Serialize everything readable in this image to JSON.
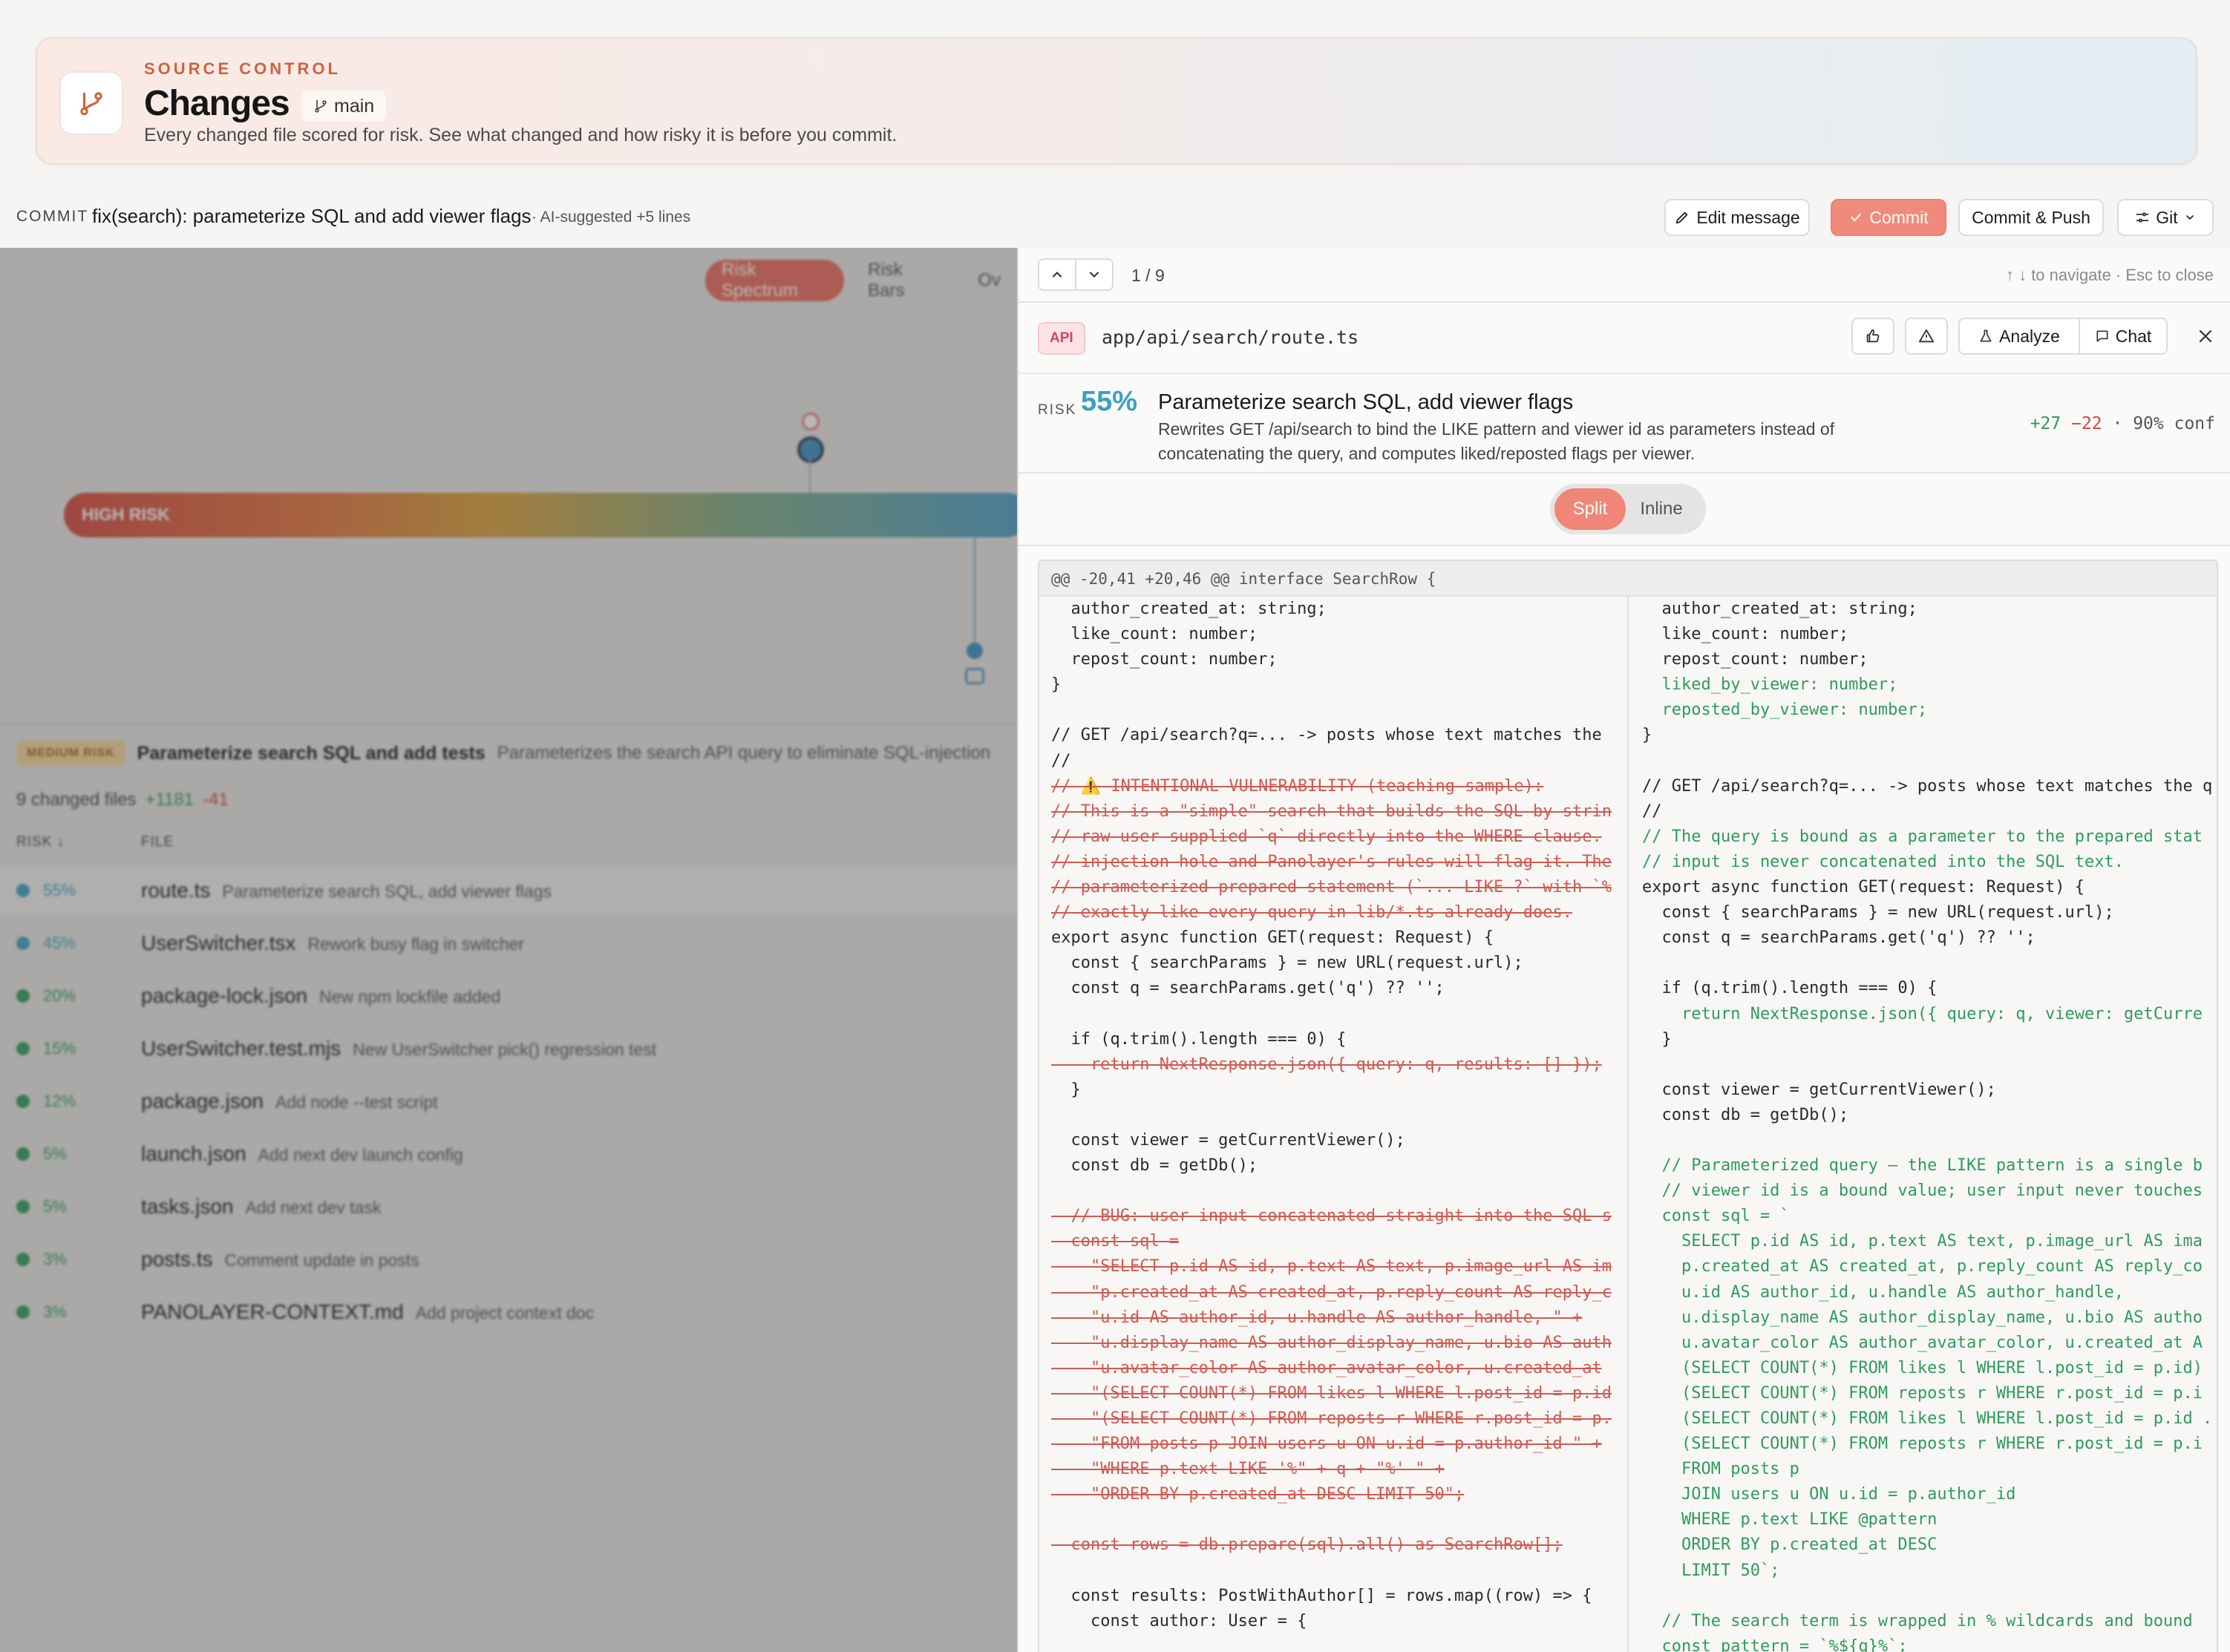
{
  "header": {
    "kicker": "SOURCE CONTROL",
    "title": "Changes",
    "branch": "main",
    "subtitle": "Every changed file scored for risk. See what changed and how risky it is before you commit."
  },
  "commit_bar": {
    "label": "COMMIT",
    "message": "fix(search): parameterize SQL and add viewer flags",
    "meta": "· AI-suggested  +5 lines",
    "edit_label": "Edit message",
    "commit_label": "Commit",
    "commit_push_label": "Commit & Push",
    "git_label": "Git"
  },
  "left": {
    "tabs": [
      "Risk Spectrum",
      "Risk Bars",
      "Ov"
    ],
    "spectrum_label": "HIGH RISK",
    "summary_badge": "MEDIUM RISK",
    "summary_title": "Parameterize search SQL and add tests",
    "summary_desc": "Parameterizes the search API query to eliminate SQL-injection",
    "changed_files": "9 changed files",
    "total_add": "+1181",
    "total_del": "-41",
    "col_risk": "RISK",
    "col_file": "FILE",
    "files": [
      {
        "pct": "55%",
        "name": "route.ts",
        "desc": "Parameterize search SQL, add viewer flags",
        "color": "#3aa0c4"
      },
      {
        "pct": "45%",
        "name": "UserSwitcher.tsx",
        "desc": "Rework busy flag in switcher",
        "color": "#3aa0c4"
      },
      {
        "pct": "20%",
        "name": "package-lock.json",
        "desc": "New npm lockfile added",
        "color": "#2f9b5c"
      },
      {
        "pct": "15%",
        "name": "UserSwitcher.test.mjs",
        "desc": "New UserSwitcher pick() regression test",
        "color": "#2f9b5c"
      },
      {
        "pct": "12%",
        "name": "package.json",
        "desc": "Add node --test script",
        "color": "#2f9b5c"
      },
      {
        "pct": "5%",
        "name": "launch.json",
        "desc": "Add next dev launch config",
        "color": "#2f9b5c"
      },
      {
        "pct": "5%",
        "name": "tasks.json",
        "desc": "Add next dev task",
        "color": "#2f9b5c"
      },
      {
        "pct": "3%",
        "name": "posts.ts",
        "desc": "Comment update in posts",
        "color": "#2f9b5c"
      },
      {
        "pct": "3%",
        "name": "PANOLAYER-CONTEXT.md",
        "desc": "Add project context doc",
        "color": "#2f9b5c"
      }
    ]
  },
  "detail": {
    "position": "1 / 9",
    "nav_hint": "↑ ↓ to navigate · Esc to close",
    "badge": "API",
    "path": "app/api/search/route.ts",
    "analyze_label": "Analyze",
    "chat_label": "Chat",
    "risk_label": "RISK",
    "risk_pct": "55%",
    "title": "Parameterize search SQL, add viewer flags",
    "desc": "Rewrites GET /api/search to bind the LIKE pattern and viewer id as parameters instead of concatenating the query, and computes liked/reposted flags per viewer.",
    "adds": "+27",
    "dels": "−22",
    "conf": "· 90% conf",
    "split_label": "Split",
    "inline_label": "Inline",
    "hunk": "@@ -20,41 +20,46 @@ interface SearchRow {",
    "left_lines": [
      {
        "t": "ctx",
        "s": "  author_created_at: string;"
      },
      {
        "t": "ctx",
        "s": "  like_count: number;"
      },
      {
        "t": "ctx",
        "s": "  repost_count: number;"
      },
      {
        "t": "ctx",
        "s": "}"
      },
      {
        "t": "ctx",
        "s": ""
      },
      {
        "t": "ctx",
        "s": "// GET /api/search?q=... -> posts whose text matches the"
      },
      {
        "t": "ctx",
        "s": "//"
      },
      {
        "t": "del",
        "s": "// ⚠️ INTENTIONAL VULNERABILITY (teaching sample):"
      },
      {
        "t": "del",
        "s": "// This is a \"simple\" search that builds the SQL by strin"
      },
      {
        "t": "del",
        "s": "// raw user-supplied `q` directly into the WHERE clause."
      },
      {
        "t": "del",
        "s": "// injection hole and Panolayer's rules will flag it. The"
      },
      {
        "t": "del",
        "s": "// parameterized prepared statement (`... LIKE ?` with `%"
      },
      {
        "t": "del",
        "s": "// exactly like every query in lib/*.ts already does."
      },
      {
        "t": "ctx",
        "s": "export async function GET(request: Request) {"
      },
      {
        "t": "ctx",
        "s": "  const { searchParams } = new URL(request.url);"
      },
      {
        "t": "ctx",
        "s": "  const q = searchParams.get('q') ?? '';"
      },
      {
        "t": "ctx",
        "s": ""
      },
      {
        "t": "ctx",
        "s": "  if (q.trim().length === 0) {"
      },
      {
        "t": "del",
        "s": "    return NextResponse.json({ query: q, results: [] });"
      },
      {
        "t": "ctx",
        "s": "  }"
      },
      {
        "t": "ctx",
        "s": ""
      },
      {
        "t": "ctx",
        "s": "  const viewer = getCurrentViewer();"
      },
      {
        "t": "ctx",
        "s": "  const db = getDb();"
      },
      {
        "t": "ctx",
        "s": ""
      },
      {
        "t": "del",
        "s": "  // BUG: user input concatenated straight into the SQL s"
      },
      {
        "t": "del",
        "s": "  const sql ="
      },
      {
        "t": "del",
        "s": "    \"SELECT p.id AS id, p.text AS text, p.image_url AS im"
      },
      {
        "t": "del",
        "s": "    \"p.created_at AS created_at, p.reply_count AS reply_c"
      },
      {
        "t": "del",
        "s": "    \"u.id AS author_id, u.handle AS author_handle, \" +"
      },
      {
        "t": "del",
        "s": "    \"u.display_name AS author_display_name, u.bio AS auth"
      },
      {
        "t": "del",
        "s": "    \"u.avatar_color AS author_avatar_color, u.created_at"
      },
      {
        "t": "del",
        "s": "    \"(SELECT COUNT(*) FROM likes l WHERE l.post_id = p.id"
      },
      {
        "t": "del",
        "s": "    \"(SELECT COUNT(*) FROM reposts r WHERE r.post_id = p."
      },
      {
        "t": "del",
        "s": "    \"FROM posts p JOIN users u ON u.id = p.author_id \" +"
      },
      {
        "t": "del",
        "s": "    \"WHERE p.text LIKE '%\" + q + \"%' \" +"
      },
      {
        "t": "del",
        "s": "    \"ORDER BY p.created_at DESC LIMIT 50\";"
      },
      {
        "t": "ctx",
        "s": ""
      },
      {
        "t": "del",
        "s": "  const rows = db.prepare(sql).all() as SearchRow[];"
      },
      {
        "t": "ctx",
        "s": ""
      },
      {
        "t": "ctx",
        "s": "  const results: PostWithAuthor[] = rows.map((row) => {"
      },
      {
        "t": "ctx",
        "s": "    const author: User = {"
      }
    ],
    "right_lines": [
      {
        "t": "ctx",
        "s": "  author_created_at: string;"
      },
      {
        "t": "ctx",
        "s": "  like_count: number;"
      },
      {
        "t": "ctx",
        "s": "  repost_count: number;"
      },
      {
        "t": "add",
        "s": "  liked_by_viewer: number;"
      },
      {
        "t": "add",
        "s": "  reposted_by_viewer: number;"
      },
      {
        "t": "ctx",
        "s": "}"
      },
      {
        "t": "ctx",
        "s": ""
      },
      {
        "t": "ctx",
        "s": "// GET /api/search?q=... -> posts whose text matches the q"
      },
      {
        "t": "ctx",
        "s": "//"
      },
      {
        "t": "add",
        "s": "// The query is bound as a parameter to the prepared stat"
      },
      {
        "t": "add",
        "s": "// input is never concatenated into the SQL text."
      },
      {
        "t": "ctx",
        "s": "export async function GET(request: Request) {"
      },
      {
        "t": "ctx",
        "s": "  const { searchParams } = new URL(request.url);"
      },
      {
        "t": "ctx",
        "s": "  const q = searchParams.get('q') ?? '';"
      },
      {
        "t": "ctx",
        "s": ""
      },
      {
        "t": "ctx",
        "s": "  if (q.trim().length === 0) {"
      },
      {
        "t": "add",
        "s": "    return NextResponse.json({ query: q, viewer: getCurre"
      },
      {
        "t": "ctx",
        "s": "  }"
      },
      {
        "t": "ctx",
        "s": ""
      },
      {
        "t": "ctx",
        "s": "  const viewer = getCurrentViewer();"
      },
      {
        "t": "ctx",
        "s": "  const db = getDb();"
      },
      {
        "t": "ctx",
        "s": ""
      },
      {
        "t": "add",
        "s": "  // Parameterized query — the LIKE pattern is a single b"
      },
      {
        "t": "add",
        "s": "  // viewer id is a bound value; user input never touches"
      },
      {
        "t": "add",
        "s": "  const sql = `"
      },
      {
        "t": "add",
        "s": "    SELECT p.id AS id, p.text AS text, p.image_url AS ima"
      },
      {
        "t": "add",
        "s": "    p.created_at AS created_at, p.reply_count AS reply_co"
      },
      {
        "t": "add",
        "s": "    u.id AS author_id, u.handle AS author_handle,"
      },
      {
        "t": "add",
        "s": "    u.display_name AS author_display_name, u.bio AS autho"
      },
      {
        "t": "add",
        "s": "    u.avatar_color AS author_avatar_color, u.created_at A"
      },
      {
        "t": "add",
        "s": "    (SELECT COUNT(*) FROM likes l WHERE l.post_id = p.id)"
      },
      {
        "t": "add",
        "s": "    (SELECT COUNT(*) FROM reposts r WHERE r.post_id = p.i"
      },
      {
        "t": "add",
        "s": "    (SELECT COUNT(*) FROM likes l WHERE l.post_id = p.id ."
      },
      {
        "t": "add",
        "s": "    (SELECT COUNT(*) FROM reposts r WHERE r.post_id = p.i"
      },
      {
        "t": "add",
        "s": "    FROM posts p"
      },
      {
        "t": "add",
        "s": "    JOIN users u ON u.id = p.author_id"
      },
      {
        "t": "add",
        "s": "    WHERE p.text LIKE @pattern"
      },
      {
        "t": "add",
        "s": "    ORDER BY p.created_at DESC"
      },
      {
        "t": "add",
        "s": "    LIMIT 50`;"
      },
      {
        "t": "ctx",
        "s": ""
      },
      {
        "t": "add",
        "s": "  // The search term is wrapped in % wildcards and bound"
      },
      {
        "t": "add",
        "s": "  const pattern = `%${q}%`;"
      }
    ]
  }
}
